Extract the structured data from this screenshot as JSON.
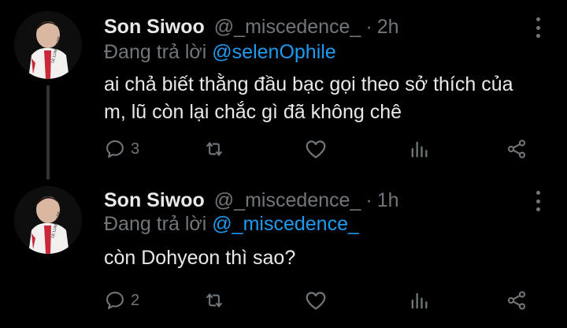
{
  "tweets": [
    {
      "name": "Son Siwoo",
      "handle": "@_miscedence_",
      "separator": "·",
      "time": "2h",
      "reply_prefix": "Đang trả lời",
      "reply_to": "@selenOphile",
      "text_line1": "ai chả biết thằng đầu bạc gọi theo sở thích của",
      "text_line2": "m, lũ còn lại chắc gì đã không chê",
      "reply_count": "3"
    },
    {
      "name": "Son Siwoo",
      "handle": "@_miscedence_",
      "separator": "·",
      "time": "1h",
      "reply_prefix": "Đang trả lời",
      "reply_to": "@_miscedence_",
      "text_line1": "còn Dohyeon thì sao?",
      "reply_count": "2"
    }
  ],
  "colors": {
    "background": "#000000",
    "text": "#e7e9ea",
    "muted": "#71767b",
    "link": "#1d9bf0",
    "thread_line": "#2f3336"
  },
  "icons": [
    "more-icon",
    "reply-icon",
    "retweet-icon",
    "like-icon",
    "analytics-icon",
    "share-icon"
  ],
  "avatar_jacket_text": "LE LUMINAIRE"
}
